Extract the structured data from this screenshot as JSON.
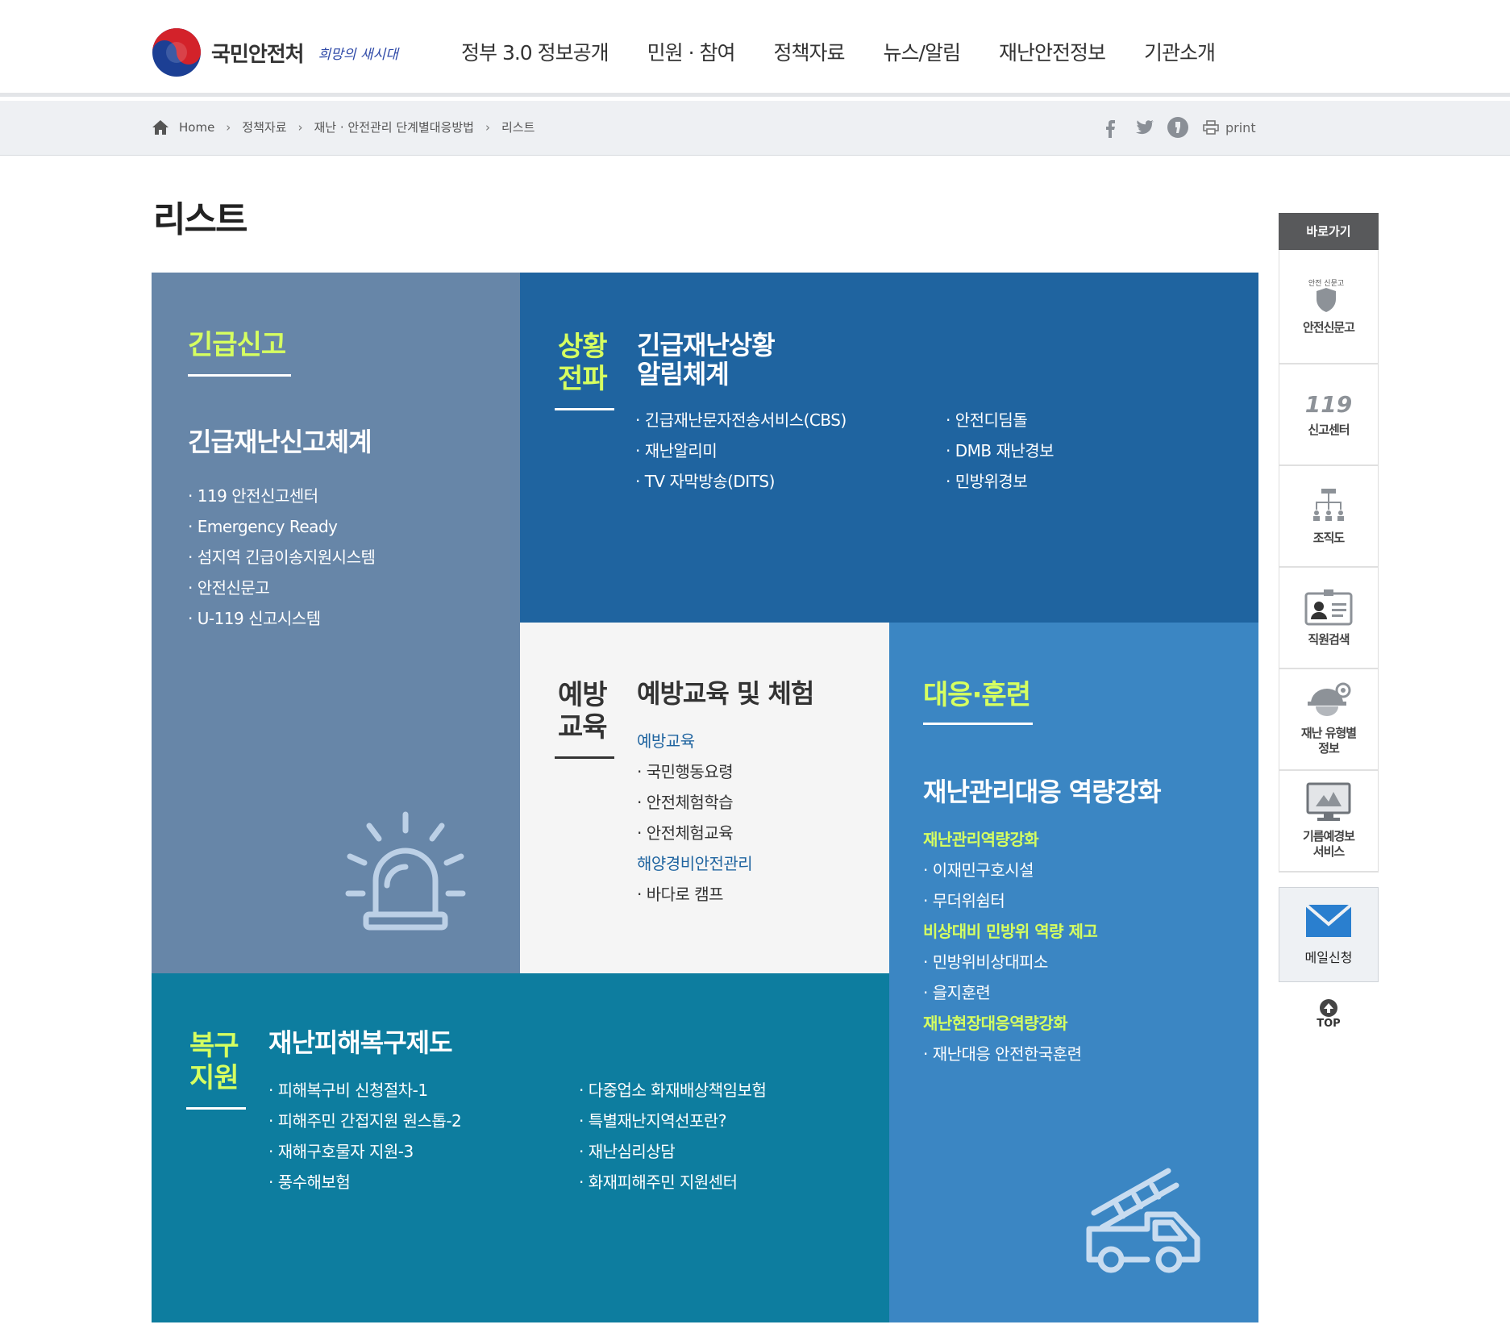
{
  "header": {
    "logo_text": "국민안전처",
    "slogan": "희망의 새시대",
    "nav": [
      "정부 3.0 정보공개",
      "민원 · 참여",
      "정책자료",
      "뉴스/알림",
      "재난안전정보",
      "기관소개"
    ]
  },
  "breadcrumb": {
    "home": "Home",
    "items": [
      "정책자료",
      "재난 · 안전관리 단계별대응방법",
      "리스트"
    ],
    "print": "print"
  },
  "page_title": "리스트",
  "tiles": {
    "report": {
      "category": "긴급신고",
      "heading": "긴급재난신고체계",
      "items": [
        "119 안전신고센터",
        "Emergency Ready",
        "섬지역 긴급이송지원시스템",
        "안전신문고",
        "U-119 신고시스템"
      ]
    },
    "propagate": {
      "category_line1": "상황",
      "category_line2": "전파",
      "heading_line1": "긴급재난상황",
      "heading_line2": "알림체계",
      "items_left": [
        "긴급재난문자전송서비스(CBS)",
        "재난알리미",
        "TV 자막방송(DITS)"
      ],
      "items_right": [
        "안전디딤돌",
        "DMB 재난경보",
        "민방위경보"
      ]
    },
    "prevent": {
      "category_line1": "예방",
      "category_line2": "교육",
      "heading": "예방교육 및 체험",
      "group1": "예방교육",
      "group1_items": [
        "국민행동요령",
        "안전체험학습",
        "안전체험교육"
      ],
      "group2": "해양경비안전관리",
      "group2_items": [
        "바다로 캠프"
      ]
    },
    "response": {
      "category": "대응·훈련",
      "heading": "재난관리대응 역량강화",
      "group1": "재난관리역량강화",
      "group1_items": [
        "이재민구호시설",
        "무더위쉼터"
      ],
      "group2": "비상대비 민방위 역량 제고",
      "group2_items": [
        "민방위비상대피소",
        "을지훈련"
      ],
      "group3": "재난현장대응역량강화",
      "group3_items": [
        "재난대응 안전한국훈련"
      ]
    },
    "recovery": {
      "category_line1": "복구",
      "category_line2": "지원",
      "heading": "재난피해복구제도",
      "items_left": [
        "피해복구비 신청절차-1",
        "피해주민 간접지원 원스톱-2",
        "재해구호물자 지원-3",
        "풍수해보험"
      ],
      "items_right": [
        "다중업소 화재배상책임보험",
        "특별재난지역선포란?",
        "재난심리상담",
        "화재피해주민 지원센터"
      ]
    }
  },
  "quick_menu": {
    "title": "바로가기",
    "items": [
      {
        "label": "안전신문고",
        "icon_text": "안전 신문고"
      },
      {
        "label": "신고센터",
        "icon_text": "119"
      },
      {
        "label": "조직도"
      },
      {
        "label": "직원검색"
      },
      {
        "label_line1": "재난 유형별",
        "label_line2": "정보"
      },
      {
        "label_line1": "기름예경보",
        "label_line2": "서비스"
      }
    ],
    "mail": "메일신청",
    "top": "TOP"
  },
  "colors": {
    "report_bg": "#6786a8",
    "propagate_bg": "#1f64a0",
    "prevent_bg": "#f5f5f5",
    "response_bg": "#3b86c3",
    "recovery_bg": "#0d7d9f",
    "accent_green": "#d6ff60"
  }
}
